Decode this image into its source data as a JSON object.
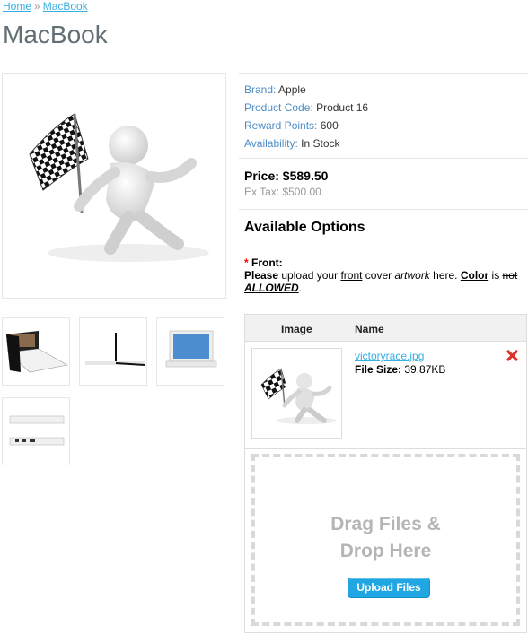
{
  "breadcrumb": {
    "home": "Home",
    "separator": "»",
    "current": "MacBook"
  },
  "page_title": "MacBook",
  "product_info": {
    "brand_label": "Brand:",
    "brand": "Apple",
    "code_label": "Product Code:",
    "code": "Product 16",
    "reward_label": "Reward Points:",
    "reward": "600",
    "availability_label": "Availability:",
    "availability": "In Stock"
  },
  "price": {
    "label": "Price: $589.50",
    "ex_tax": "Ex Tax: $500.00"
  },
  "options": {
    "title": "Available Options",
    "required_mark": "*",
    "front_label": "Front:",
    "instructions": {
      "please": "Please",
      "upload_your": " upload your ",
      "front": "front",
      "cover": " cover ",
      "artwork": "artwork",
      "here": " here. ",
      "color": "Color",
      "is": " is ",
      "not": "not",
      "allowed": "ALLOWED",
      "period": "."
    }
  },
  "upload": {
    "col_image": "Image",
    "col_name": "Name",
    "file_name": "victoryrace.jpg",
    "file_size_label": "File Size:",
    "file_size": "39.87KB",
    "drop_line1": "Drag Files &",
    "drop_line2": "Drop Here",
    "button": "Upload Files"
  },
  "colors": {
    "link": "#38b0e3",
    "label": "#4d8dc4",
    "button": "#1fa6e3",
    "remove": "#e0302a"
  },
  "icons": {
    "remove": "close-x-icon"
  }
}
